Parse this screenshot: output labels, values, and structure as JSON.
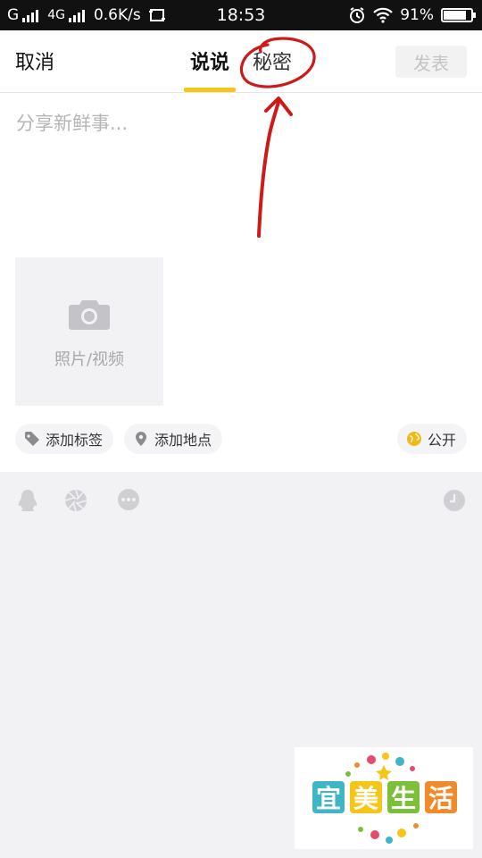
{
  "status_bar": {
    "net1": "G",
    "net2": "4G",
    "speed": "0.6K/s",
    "time": "18:53",
    "battery": "91%",
    "battery_level": 0.91
  },
  "nav": {
    "cancel": "取消",
    "tab_shuoshuo": "说说",
    "tab_secret": "秘密",
    "publish": "发表"
  },
  "compose": {
    "placeholder": "分享新鲜事...",
    "photo_label": "照片/视频"
  },
  "chips": {
    "tag": "添加标签",
    "location": "添加地点",
    "visibility": "公开"
  },
  "watermark": {
    "chars": [
      "宜",
      "美",
      "生",
      "活"
    ]
  },
  "colors": {
    "accent": "#f5c518",
    "annotation": "#cc1a1a"
  }
}
